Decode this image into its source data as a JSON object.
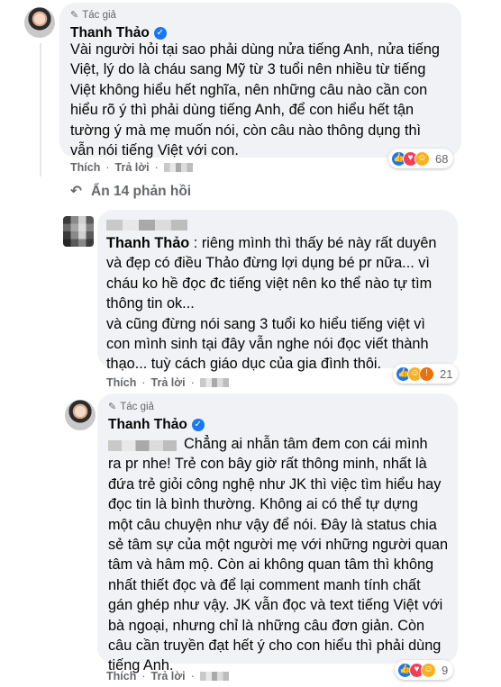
{
  "colors": {
    "accent": "#1877f2",
    "bubble": "#f0f2f5",
    "secondary_text": "#65676b"
  },
  "comment1": {
    "author_tag": "Tác giả",
    "author": "Thanh Thảo",
    "avatar_icon": "celebrity-avatar",
    "text": "Vài người hỏi tại sao phải dùng nửa tiếng Anh, nửa tiếng\nViệt, lý do là cháu sang Mỹ từ 3 tuổi nên nhiều từ tiếng\nViệt không hiểu hết nghĩa, nên những câu nào cần con\nhiểu rõ ý thì phải dùng tiếng Anh, để con hiểu hết tận\ntường ý mà mẹ muốn nói, còn câu nào thông dụng thì\nvẫn nói tiếng Việt với con.",
    "like_label": "Thích",
    "reply_label": "Trả lời",
    "reaction_count": "68"
  },
  "hidden_replies": {
    "label": "Ẩn 14 phản hồi",
    "icon": "return-arrow-icon"
  },
  "comment2": {
    "avatar_icon": "pixelated-avatar",
    "mention": "Thanh Thảo",
    "text_first": " : riêng mình thì thấy bé này rất duyên\nvà đẹp có điều Thảo đừng lợi dụng bé pr nữa... vì\ncháu ko hề đọc đc tiếng việt nên ko thể nào tự tìm\nthông tin ok...\nvà cũng đừng nói sang 3 tuổi ko hiểu tiếng việt vì\ncon mình sinh tại đây vẫn nghe nói đọc viết thành\nthạo... tuỳ cách giáo dục của gia đình thôi.",
    "like_label": "Thích",
    "reply_label": "Trả lời",
    "reaction_count": "21"
  },
  "comment3": {
    "author_tag": "Tác giả",
    "author": "Thanh Thảo",
    "avatar_icon": "celebrity-avatar",
    "text": "Chẳng ai nhẫn tâm đem con cái mình\nra pr nhe! Trẻ con bây giờ rất thông minh, nhất là\nđứa trẻ giỏi công nghệ như JK thì việc tìm hiểu hay\nđọc tin là bình thường. Không ai có thể tự dựng\nmột câu chuyện như vậy để nói. Đây là status chia\nsẻ tâm sự của một người mẹ với những người quan\ntâm và hâm mộ. Còn ai không quan tâm thì không\nnhất thiết đọc và để lại comment manh tính chất\ngán ghép như vậy. JK vẫn đọc và text tiếng Việt với\nbà ngoại, nhưng chỉ là những câu đơn giản. Còn\ncâu cần truyền đạt hết ý cho con hiểu thì phải dùng\ntiếng Anh.",
    "like_label": "Thích",
    "reply_label": "Trả lời",
    "reaction_count": "9"
  }
}
